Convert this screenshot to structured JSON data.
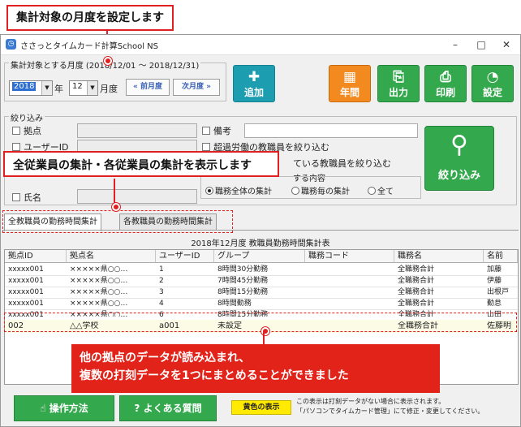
{
  "callouts": {
    "top": "集計対象の月度を設定します",
    "middle": "全従業員の集計・各従業員の集計を表示します",
    "bottom_line1": "他の拠点のデータが読み込まれ、",
    "bottom_line2": "複数の打刻データを1つにまとめることができました"
  },
  "window": {
    "title": "ささっとタイムカード計算School NS",
    "minimize": "–",
    "maximize": "□",
    "close": "✕"
  },
  "month": {
    "legend": "集計対象とする月度 (2018/12/01 〜 2018/12/31)",
    "year_value": "2018",
    "year_unit": "年",
    "month_value": "12",
    "month_unit": "月度",
    "prev_label": "« 前月度",
    "next_label": "次月度 »"
  },
  "toolbar": {
    "add_label": "追加",
    "annual_label": "年間",
    "output_label": "出力",
    "print_label": "印刷",
    "settings_label": "設定"
  },
  "filter": {
    "legend": "絞り込み",
    "base_label": "拠点",
    "user_id_label": "ユーザーID",
    "name_label": "氏名",
    "note_label": "備考",
    "overtime_label": "超過労働の教職員を絞り込む",
    "partial_label": "ている教職員を絞り込む",
    "content_legend": "する内容",
    "radio_all": "職務全体の集計",
    "radio_each": "職務毎の集計",
    "radio_total": "全て",
    "button_label": "絞り込み"
  },
  "tabs": [
    "全教職員の勤務時間集計",
    "各教職員の勤務時間集計"
  ],
  "table": {
    "caption": "2018年12月度 教職員勤務時間集計表",
    "headers": [
      "拠点ID",
      "拠点名",
      "ユーザーID",
      "グループ",
      "職務コード",
      "職務名",
      "名前"
    ],
    "rows": [
      [
        "xxxxx001",
        "×××××県○○…",
        "1",
        "8時間30分勤務",
        "",
        "全職務合計",
        "加藤"
      ],
      [
        "xxxxx001",
        "×××××県○○…",
        "2",
        "7時間45分勤務",
        "",
        "全職務合計",
        "伊藤"
      ],
      [
        "xxxxx001",
        "×××××県○○…",
        "3",
        "8時間15分勤務",
        "",
        "全職務合計",
        "出根戸"
      ],
      [
        "xxxxx001",
        "×××××県○○…",
        "4",
        "8時間勤務",
        "",
        "全職務合計",
        "勤怠"
      ],
      [
        "xxxxx001",
        "×××××県○○…",
        "6",
        "8時間15分勤務",
        "",
        "全職務合計",
        "山田"
      ]
    ],
    "highlight_row": [
      "002",
      "△△学校",
      "a001",
      "未設定",
      "",
      "全職務合計",
      "佐藤明"
    ]
  },
  "footer": {
    "howto_label": "操作方法",
    "faq_label": "よくある質問",
    "yellow_label": "黄色の表示",
    "note_line1": "この表示は打刻データがない場合に表示されます。",
    "note_line2": "「パソコンでタイムカード管理」にて修正・変更してください。"
  },
  "colors": {
    "accent_red": "#e02020",
    "teal": "#1d9db0",
    "orange": "#f28a20",
    "green": "#34a84d",
    "highlight_yellow": "#ffea00"
  }
}
